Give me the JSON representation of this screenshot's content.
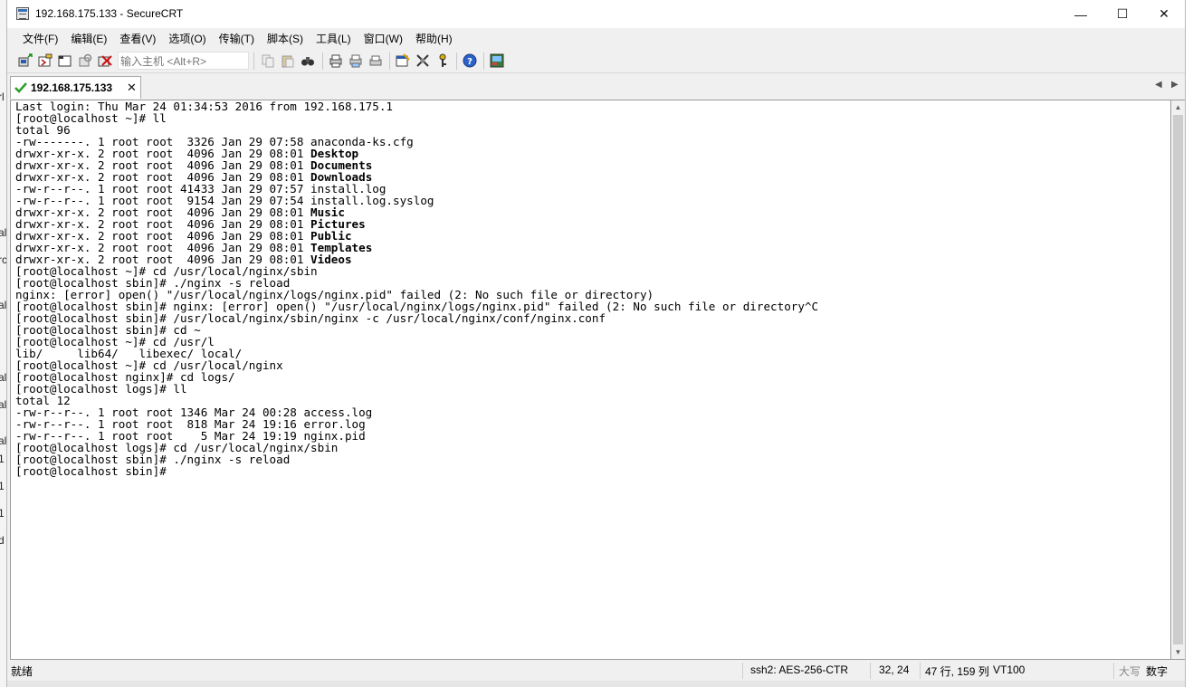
{
  "window": {
    "title": "192.168.175.133 - SecureCRT",
    "controls": {
      "minimize": "—",
      "maximize": "☐",
      "close": "✕"
    }
  },
  "behind_chars": [
    "rl",
    "al",
    "rc",
    "al",
    "al",
    "al",
    "al",
    "1",
    "1",
    "1",
    "d"
  ],
  "menu": [
    "文件(F)",
    "编辑(E)",
    "查看(V)",
    "选项(O)",
    "传输(T)",
    "脚本(S)",
    "工具(L)",
    "窗口(W)",
    "帮助(H)"
  ],
  "toolbar": {
    "host_input_placeholder": "输入主机 <Alt+R>"
  },
  "tabs": [
    {
      "label": "192.168.175.133",
      "close": "✕"
    }
  ],
  "tab_arrows": {
    "left": "◀",
    "right": "▶"
  },
  "terminal": {
    "lines": [
      {
        "text": "Last login: Thu Mar 24 01:34:53 2016 from 192.168.175.1"
      },
      {
        "text": "[root@localhost ~]# ll"
      },
      {
        "text": "total 96"
      },
      {
        "text": "-rw-------. 1 root root  3326 Jan 29 07:58 ",
        "name": "anaconda-ks.cfg"
      },
      {
        "text": "drwxr-xr-x. 2 root root  4096 Jan 29 08:01 ",
        "name": "Desktop",
        "bold": true
      },
      {
        "text": "drwxr-xr-x. 2 root root  4096 Jan 29 08:01 ",
        "name": "Documents",
        "bold": true
      },
      {
        "text": "drwxr-xr-x. 2 root root  4096 Jan 29 08:01 ",
        "name": "Downloads",
        "bold": true
      },
      {
        "text": "-rw-r--r--. 1 root root 41433 Jan 29 07:57 ",
        "name": "install.log"
      },
      {
        "text": "-rw-r--r--. 1 root root  9154 Jan 29 07:54 ",
        "name": "install.log.syslog"
      },
      {
        "text": "drwxr-xr-x. 2 root root  4096 Jan 29 08:01 ",
        "name": "Music",
        "bold": true
      },
      {
        "text": "drwxr-xr-x. 2 root root  4096 Jan 29 08:01 ",
        "name": "Pictures",
        "bold": true
      },
      {
        "text": "drwxr-xr-x. 2 root root  4096 Jan 29 08:01 ",
        "name": "Public",
        "bold": true
      },
      {
        "text": "drwxr-xr-x. 2 root root  4096 Jan 29 08:01 ",
        "name": "Templates",
        "bold": true
      },
      {
        "text": "drwxr-xr-x. 2 root root  4096 Jan 29 08:01 ",
        "name": "Videos",
        "bold": true
      },
      {
        "text": "[root@localhost ~]# cd /usr/local/nginx/sbin"
      },
      {
        "text": "[root@localhost sbin]# ./nginx -s reload"
      },
      {
        "text": "nginx: [error] open() \"/usr/local/nginx/logs/nginx.pid\" failed (2: No such file or directory)"
      },
      {
        "text": "[root@localhost sbin]# nginx: [error] open() \"/usr/local/nginx/logs/nginx.pid\" failed (2: No such file or directory^C"
      },
      {
        "text": "[root@localhost sbin]# /usr/local/nginx/sbin/nginx -c /usr/local/nginx/conf/nginx.conf"
      },
      {
        "text": "[root@localhost sbin]# cd ~"
      },
      {
        "text": "[root@localhost ~]# cd /usr/l"
      },
      {
        "text": "lib/     lib64/   libexec/ local/"
      },
      {
        "text": "[root@localhost ~]# cd /usr/local/nginx"
      },
      {
        "text": "[root@localhost nginx]# cd logs/"
      },
      {
        "text": "[root@localhost logs]# ll"
      },
      {
        "text": "total 12"
      },
      {
        "text": "-rw-r--r--. 1 root root 1346 Mar 24 00:28 access.log"
      },
      {
        "text": "-rw-r--r--. 1 root root  818 Mar 24 19:16 error.log"
      },
      {
        "text": "-rw-r--r--. 1 root root    5 Mar 24 19:19 nginx.pid"
      },
      {
        "text": "[root@localhost logs]# cd /usr/local/nginx/sbin"
      },
      {
        "text": "[root@localhost sbin]# ./nginx -s reload"
      },
      {
        "text": "[root@localhost sbin]# "
      }
    ]
  },
  "scrollbar": {
    "up": "▲",
    "down": "▼"
  },
  "status": {
    "ready": "就绪",
    "cipher": "ssh2: AES-256-CTR",
    "cursor": "32,  24",
    "size": "47 行, 159 列",
    "emulation": "VT100",
    "caps": "大写",
    "num": "数字"
  }
}
